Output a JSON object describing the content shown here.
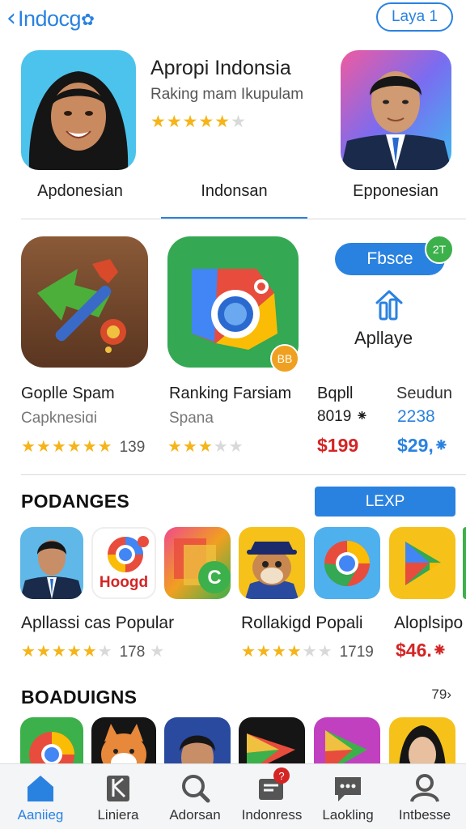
{
  "header": {
    "back_title": "Indocg",
    "right_pill": "Laya 1"
  },
  "hero": {
    "title": "Apropi Indonsia",
    "subtitle": "Raking mam Ikupulam",
    "rating": 5,
    "stars_filled": 5
  },
  "tabs": [
    {
      "label": "Apdonesian"
    },
    {
      "label": "Indonsan"
    },
    {
      "label": "Epponesian"
    }
  ],
  "featured": [
    {
      "name": "Goplle Spam",
      "category": "Capknesiɑi",
      "stars": 6,
      "count": "139"
    },
    {
      "name": "Ranking Farsiam",
      "category": "Spana",
      "stars": 3,
      "badge": "BB"
    },
    {
      "name": "Bqpll",
      "sub": "8019 ⁕",
      "price": "$199"
    },
    {
      "name": "Seudun",
      "sub": "2238",
      "price": "$29,⁕"
    }
  ],
  "flash": {
    "pill": "Fbsce",
    "badge": "2T",
    "apply": "Apllaye"
  },
  "section1": {
    "title": "PODANGES",
    "button": "LEXP",
    "tile_label": "Hoogd",
    "items": [
      {
        "name": "Apllassi cas Popular",
        "stars": 5,
        "count": "178"
      },
      {
        "name": "Rollakigd Popali",
        "stars": 4,
        "count": "1719"
      },
      {
        "name": "Aloplsipo",
        "price": "$46.⁕"
      }
    ]
  },
  "section2": {
    "title": "BOADUIGNS",
    "more": "79›"
  },
  "nav": [
    {
      "label": "Aaniieg",
      "icon": "home-icon"
    },
    {
      "label": "Liniera",
      "icon": "bookmark-icon"
    },
    {
      "label": "Adorsan",
      "icon": "search-icon"
    },
    {
      "label": "Indonress",
      "icon": "inbox-icon",
      "badge": "?"
    },
    {
      "label": "Laokling",
      "icon": "chat-icon"
    },
    {
      "label": "Intbesse",
      "icon": "profile-icon"
    }
  ],
  "colors": {
    "accent": "#2a82e0",
    "star": "#f5b418",
    "price_red": "#d42424",
    "badge_green": "#3cb04a"
  }
}
